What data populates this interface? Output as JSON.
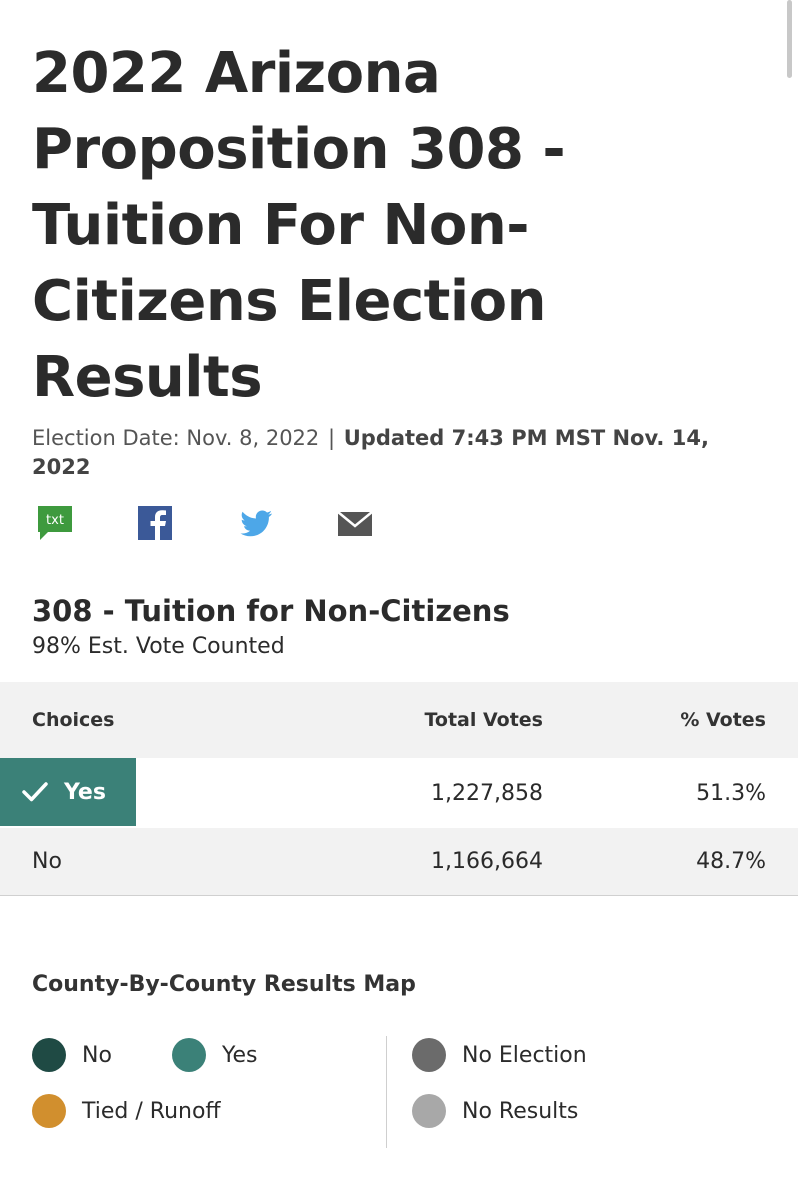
{
  "header": {
    "title": "2022 Arizona Proposition 308 - Tuition For Non-Citizens Election Results",
    "election_date": "Election Date: Nov. 8, 2022",
    "separator": "|",
    "updated": "Updated 7:43 PM MST Nov. 14, 2022"
  },
  "share": {
    "icons": [
      "txt-icon",
      "facebook-icon",
      "twitter-icon",
      "email-icon"
    ],
    "txt_label": "txt",
    "colors": {
      "txt": "#3e9a3e",
      "facebook": "#3b5998",
      "twitter": "#4da7e8",
      "email": "#555555"
    }
  },
  "race": {
    "title": "308 - Tuition for Non-Citizens",
    "counted": "98% Est. Vote Counted",
    "columns": {
      "choice": "Choices",
      "total": "Total Votes",
      "pct": "% Votes"
    },
    "rows": [
      {
        "choice": "Yes",
        "total": "1,227,858",
        "pct": "51.3%",
        "winner": true
      },
      {
        "choice": "No",
        "total": "1,166,664",
        "pct": "48.7%",
        "winner": false
      }
    ],
    "winner_color": "#3b8178"
  },
  "map": {
    "title": "County-By-County Results Map",
    "legend": [
      {
        "label": "No",
        "color": "#1f4a44"
      },
      {
        "label": "Yes",
        "color": "#3b8178"
      },
      {
        "label": "Tied / Runoff",
        "color": "#d18f2e"
      },
      {
        "label": "No Election",
        "color": "#6b6b6b"
      },
      {
        "label": "No Results",
        "color": "#a8a8a8"
      }
    ]
  }
}
